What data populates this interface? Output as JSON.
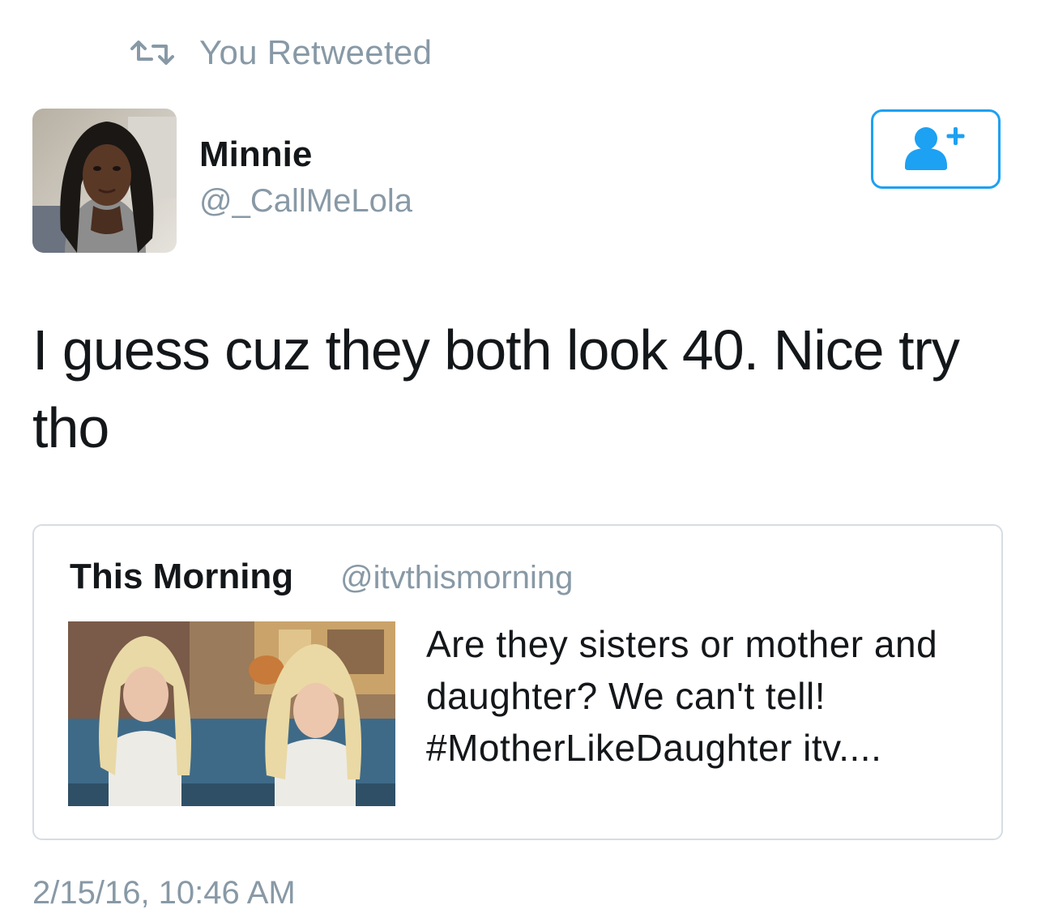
{
  "retweet_banner": {
    "icon": "retweet-icon",
    "label": "You Retweeted"
  },
  "author": {
    "display_name": "Minnie",
    "handle": "@_CallMeLola",
    "avatar": "avatar-photo"
  },
  "follow_button": {
    "icon": "add-user-icon",
    "accent_color": "#1da1f2"
  },
  "tweet": {
    "text": "I guess cuz they both look 40. Nice try tho",
    "timestamp": "2/15/16, 10:46 AM"
  },
  "quoted_tweet": {
    "display_name": "This Morning",
    "handle": "@itvthismorning",
    "text": "Are they sisters or mother and daughter? We can't tell! #MotherLikeDaughter itv....",
    "media": "two-women-on-sofa-photo"
  },
  "colors": {
    "text_primary": "#14171a",
    "text_secondary": "#8899a6",
    "border": "#d6dde3",
    "accent": "#1da1f2"
  }
}
